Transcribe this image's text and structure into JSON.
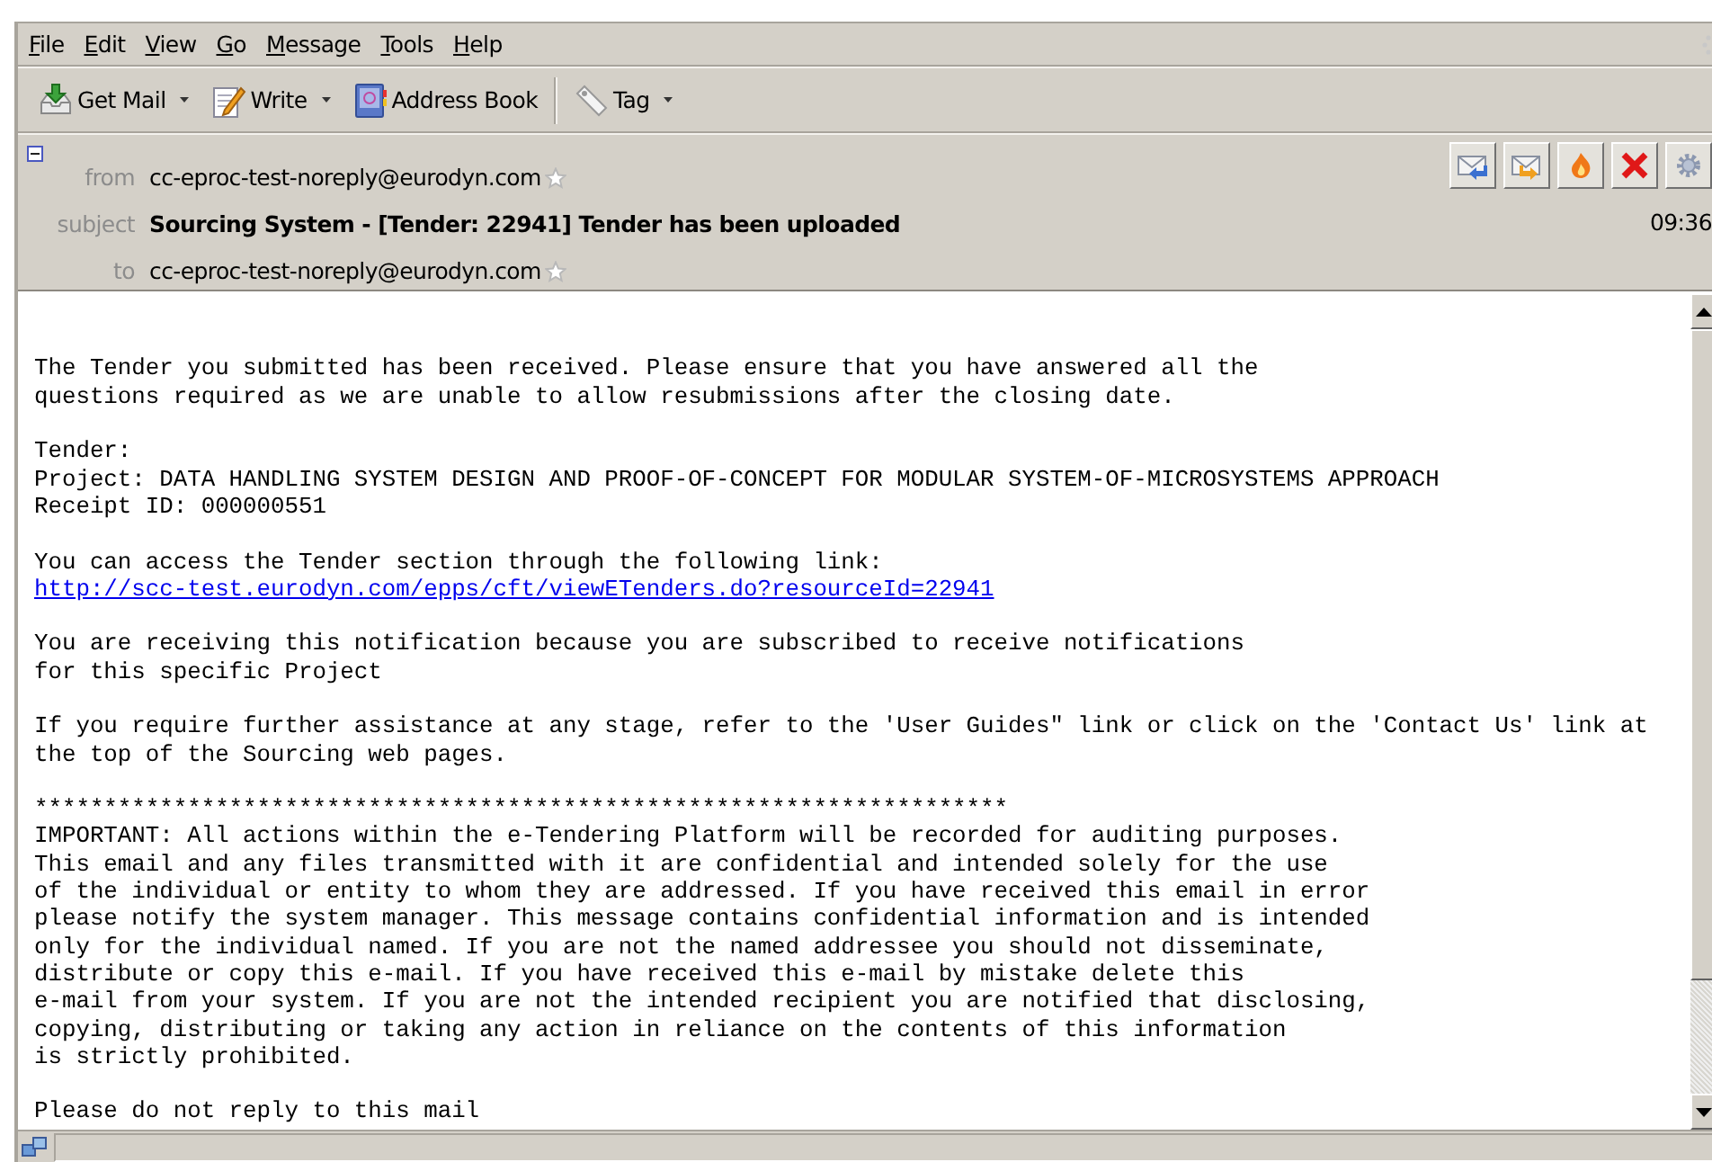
{
  "menu": [
    {
      "label": "File"
    },
    {
      "label": "Edit"
    },
    {
      "label": "View"
    },
    {
      "label": "Go"
    },
    {
      "label": "Message"
    },
    {
      "label": "Tools"
    },
    {
      "label": "Help"
    }
  ],
  "toolbar": [
    {
      "kind": "get-mail",
      "label": "Get Mail",
      "dropdown": true,
      "separator_before": false
    },
    {
      "kind": "write",
      "label": "Write",
      "dropdown": true,
      "separator_before": false
    },
    {
      "kind": "address-book",
      "label": "Address Book",
      "dropdown": false,
      "separator_before": false
    },
    {
      "kind": "tag",
      "label": "Tag",
      "dropdown": true,
      "separator_before": true
    }
  ],
  "header": {
    "fields": [
      {
        "label": "from",
        "value": "cc-eproc-test-noreply@eurodyn.com",
        "bold": false,
        "star": true
      },
      {
        "label": "subject",
        "value": "Sourcing System - [Tender: 22941] Tender has been uploaded",
        "bold": true,
        "star": false
      },
      {
        "label": "to",
        "value": "cc-eproc-test-noreply@eurodyn.com",
        "bold": false,
        "star": true
      }
    ],
    "time": "09:36",
    "actions": [
      {
        "kind": "reply"
      },
      {
        "kind": "forward"
      },
      {
        "kind": "junk"
      },
      {
        "kind": "delete"
      },
      {
        "kind": "settings"
      }
    ]
  },
  "body": [
    {
      "kind": "text",
      "text": "The Tender you submitted has been received. Please ensure that you have answered all the\nquestions required as we are unable to allow resubmissions after the closing date."
    },
    {
      "kind": "text",
      "text": "Tender:\nProject: DATA HANDLING SYSTEM DESIGN AND PROOF-OF-CONCEPT FOR MODULAR SYSTEM-OF-MICROSYSTEMS APPROACH\nReceipt ID: 000000551"
    },
    {
      "kind": "link",
      "text": "You can access the Tender section through the following link:",
      "link": "http://scc-test.eurodyn.com/epps/cft/viewETenders.do?resourceId=22941"
    },
    {
      "kind": "text",
      "text": "You are receiving this notification because you are subscribed to receive notifications\nfor this specific Project"
    },
    {
      "kind": "text",
      "text": "If you require further assistance at any stage, refer to the 'User Guides\" link or click on the 'Contact Us' link at\nthe top of the Sourcing web pages."
    },
    {
      "kind": "text",
      "text": "**********************************************************************\nIMPORTANT: All actions within the e-Tendering Platform will be recorded for auditing purposes.\nThis email and any files transmitted with it are confidential and intended solely for the use\nof the individual or entity to whom they are addressed. If you have received this email in error\nplease notify the system manager. This message contains confidential information and is intended\nonly for the individual named. If you are not the named addressee you should not disseminate,\ndistribute or copy this e-mail. If you have received this e-mail by mistake delete this\ne-mail from your system. If you are not the intended recipient you are notified that disclosing,\ncopying, distributing or taking any action in reliance on the contents of this information\nis strictly prohibited."
    },
    {
      "kind": "text",
      "text": "Please do not reply to this mail"
    }
  ]
}
